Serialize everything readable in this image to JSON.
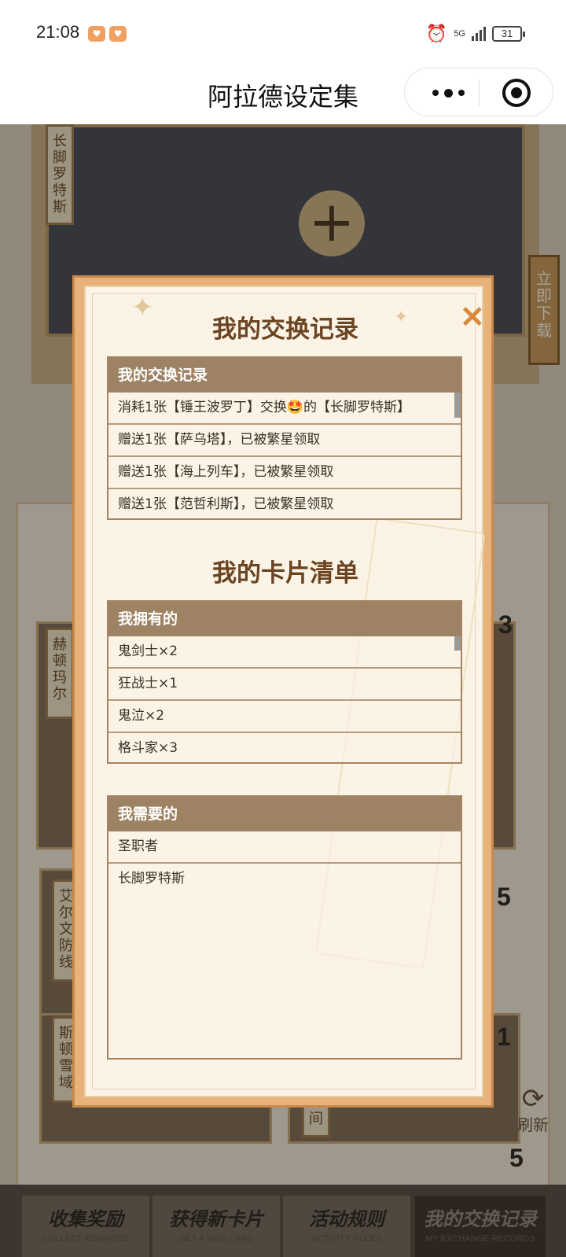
{
  "status_bar": {
    "time": "21:08",
    "network": "5G",
    "battery": "31"
  },
  "header": {
    "title": "阿拉德设定集"
  },
  "background": {
    "top_card_label": "长脚罗特斯",
    "download_label": "立即下载",
    "card_labels": [
      "赫顿玛尔",
      "艾尔文防线",
      "斯顿雪域",
      "房间"
    ],
    "counts": [
      "3",
      "5",
      "1",
      "5"
    ],
    "refresh_label": "刷新"
  },
  "modal": {
    "exchange_title": "我的交换记录",
    "exchange_box": {
      "header": "我的交换记录",
      "rows": [
        "消耗1张【锤王波罗丁】交换🤩的【长脚罗特斯】",
        "赠送1张【萨乌塔】，已被繁星领取",
        "赠送1张【海上列车】，已被繁星领取",
        "赠送1张【范哲利斯】，已被繁星领取"
      ]
    },
    "cards_title": "我的卡片清单",
    "owned_box": {
      "header": "我拥有的",
      "rows": [
        "鬼剑士×2",
        "狂战士×1",
        "鬼泣×2",
        "格斗家×3"
      ]
    },
    "needed_box": {
      "header": "我需要的",
      "rows": [
        "圣职者",
        "长脚罗特斯"
      ]
    }
  },
  "tabs": [
    {
      "cn": "收集奖励",
      "en": "COLLECT REWARDS"
    },
    {
      "cn": "获得新卡片",
      "en": "GET A NEW CARD"
    },
    {
      "cn": "活动规则",
      "en": "ACTIVITY RULES"
    },
    {
      "cn": "我的交换记录",
      "en": "MY EXCHANGE RECORDS"
    }
  ],
  "colors": {
    "modal_frame": "#e8b27a",
    "box_header": "#9e8264",
    "title_brown": "#6b4422",
    "close_orange": "#d9893a"
  }
}
